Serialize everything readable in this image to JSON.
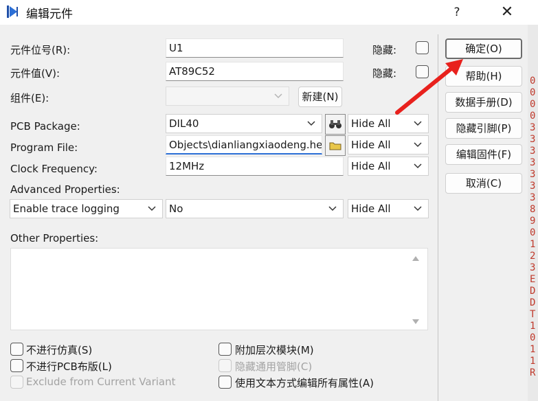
{
  "window": {
    "title": "编辑元件",
    "help_glyph": "?",
    "close_glyph": "✕"
  },
  "fields": {
    "ref_label": "元件位号(R):",
    "ref_value": "U1",
    "value_label": "元件值(V):",
    "value_value": "AT89C52",
    "group_label": "组件(E):",
    "new_button": "新建(N)",
    "hidden_label": "隐藏:"
  },
  "properties": {
    "pcb_label": "PCB Package:",
    "pcb_value": "DIL40",
    "program_label": "Program File:",
    "program_value": "Objects\\dianliangxiaodeng.hex",
    "clock_label": "Clock Frequency:",
    "clock_value": "12MHz",
    "advanced_label": "Advanced Properties:",
    "advanced_name": "Enable trace logging",
    "advanced_value": "No",
    "hide_all": "Hide All",
    "other_label": "Other Properties:"
  },
  "options": {
    "no_sim": "不进行仿真(S)",
    "no_pcb": "不进行PCB布版(L)",
    "exclude_variant": "Exclude from Current Variant",
    "attach_hier": "附加层次模块(M)",
    "hide_common_pins": "隐藏通用管脚(C)",
    "edit_as_text": "使用文本方式编辑所有属性(A)"
  },
  "buttons": {
    "ok": "确定(O)",
    "help": "帮助(H)",
    "datasheet": "数据手册(D)",
    "hidden_pins": "隐藏引脚(P)",
    "edit_firmware": "编辑固件(F)",
    "cancel": "取消(C)"
  },
  "background_strip": [
    "0",
    "0",
    "0",
    "0",
    "3",
    "3",
    "3",
    "3",
    "3",
    "3",
    "3",
    "8",
    "9",
    "0",
    "1",
    "2",
    "3",
    "E",
    "D",
    "D",
    "T",
    "1",
    "0",
    "1",
    "1",
    "R"
  ]
}
